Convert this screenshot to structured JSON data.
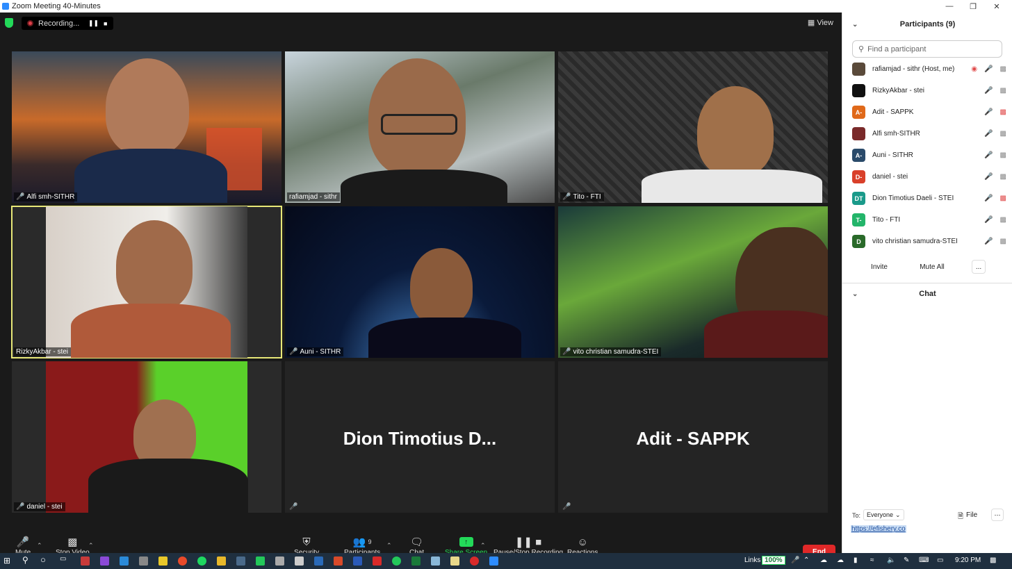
{
  "window": {
    "title": "Zoom Meeting 40-Minutes"
  },
  "topbar": {
    "recording_label": "Recording...",
    "view_label": "View"
  },
  "tiles": [
    {
      "name": "Alfi smh-SITHR",
      "muted": true,
      "video": true
    },
    {
      "name": "rafiamjad - sithr",
      "muted": false,
      "video": true
    },
    {
      "name": "Tito - FTI",
      "muted": true,
      "video": true
    },
    {
      "name": "RizkyAkbar - stei",
      "muted": false,
      "video": true,
      "active_speaker": true
    },
    {
      "name": "Auni - SITHR",
      "muted": true,
      "video": true
    },
    {
      "name": "vito christian samudra-STEI",
      "muted": true,
      "video": true
    },
    {
      "name": "daniel - stei",
      "muted": true,
      "video": true
    },
    {
      "name": "",
      "big_name": "Dion Timotius D...",
      "muted": true,
      "video": false
    },
    {
      "name": "",
      "big_name": "Adit - SAPPK",
      "muted": true,
      "video": false
    }
  ],
  "toolbar": {
    "mute": "Mute",
    "stop_video": "Stop Video",
    "security": "Security",
    "participants": "Participants",
    "participants_count": "9",
    "chat": "Chat",
    "share_screen": "Share Screen",
    "pause_recording": "Pause/Stop Recording",
    "reactions": "Reactions",
    "end": "End"
  },
  "panel": {
    "participants_title": "Participants (9)",
    "search_placeholder": "Find a participant",
    "participants": [
      {
        "name": "rafiamjad - sithr (Host, me)",
        "avatar": "",
        "color": "#5a4a3a"
      },
      {
        "name": "RizkyAkbar - stei",
        "avatar": "",
        "color": "#111111"
      },
      {
        "name": "Adit - SAPPK",
        "avatar": "A-",
        "color": "#e0691a"
      },
      {
        "name": "Alfi smh-SITHR",
        "avatar": "",
        "color": "#7a2a2a"
      },
      {
        "name": "Auni - SITHR",
        "avatar": "A-",
        "color": "#2a4a6a"
      },
      {
        "name": "daniel - stei",
        "avatar": "D-",
        "color": "#d9402a"
      },
      {
        "name": "Dion Timotius Daeli - STEI",
        "avatar": "DT",
        "color": "#1a9a8a"
      },
      {
        "name": "Tito - FTI",
        "avatar": "T-",
        "color": "#23b56a"
      },
      {
        "name": "vito christian samudra-STEI",
        "avatar": "D",
        "color": "#2a6a2a"
      }
    ],
    "invite": "Invite",
    "mute_all": "Mute All",
    "more": "...",
    "chat_title": "Chat",
    "to_label": "To:",
    "to_value": "Everyone",
    "file_label": "File",
    "chat_input": "https://efishery.co"
  },
  "taskbar": {
    "links_label": "Links",
    "zoom_level": "100%",
    "time": "9:20 PM"
  },
  "colors": {
    "accent": "#2d8cff",
    "end": "#e02828",
    "share": "#23d959",
    "active_border": "#e8e878"
  }
}
